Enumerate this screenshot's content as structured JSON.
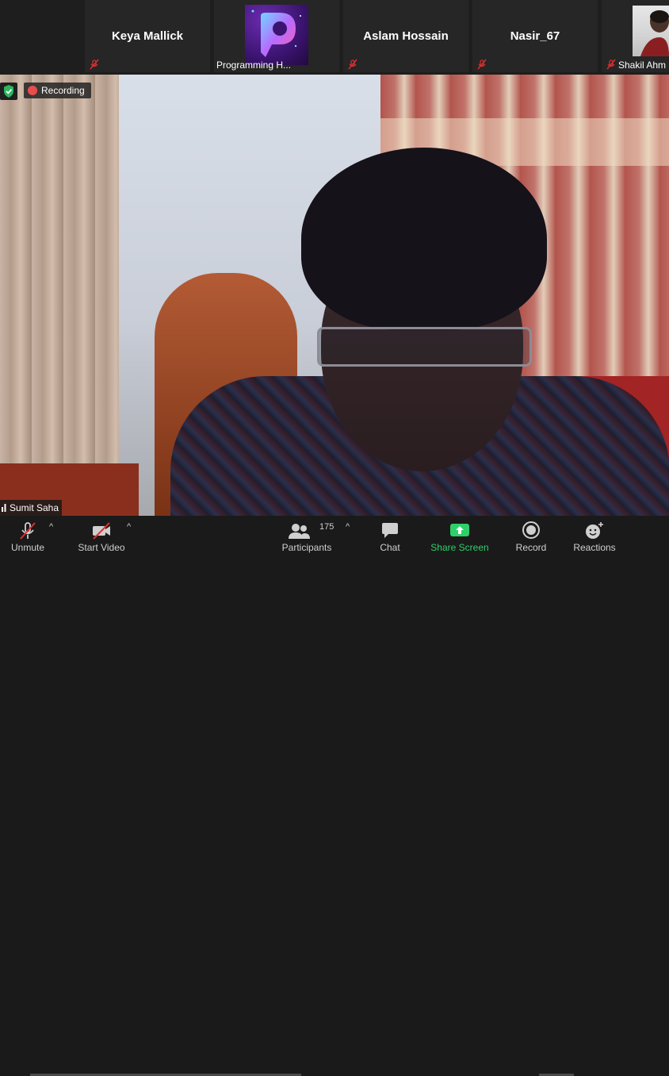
{
  "participants_strip": [
    {
      "name": "Keya Mallick",
      "muted": true
    },
    {
      "name": "Programming H...",
      "muted": false,
      "has_logo": true
    },
    {
      "name": "Aslam Hossain",
      "muted": true
    },
    {
      "name": "Nasir_67",
      "muted": true
    },
    {
      "name": "Shakil Ahm",
      "muted": true,
      "has_photo": true
    }
  ],
  "main_video": {
    "recording_label": "Recording",
    "speaker_name": "Sumit Saha"
  },
  "toolbar": {
    "unmute_label": "Unmute",
    "start_video_label": "Start Video",
    "participants_label": "Participants",
    "participants_count": "175",
    "chat_label": "Chat",
    "share_screen_label": "Share Screen",
    "record_label": "Record",
    "reactions_label": "Reactions"
  },
  "colors": {
    "share_green": "#2ed06a",
    "recording_red": "#e84d4d",
    "security_green": "#2db55d",
    "muted_red": "#e02f2f"
  },
  "icons": [
    "muted-mic-icon",
    "shield-check-icon",
    "recording-dot-icon",
    "mic-off-icon",
    "video-off-icon",
    "participants-icon",
    "chat-icon",
    "share-screen-icon",
    "record-icon",
    "reactions-icon",
    "caret-up-icon"
  ]
}
